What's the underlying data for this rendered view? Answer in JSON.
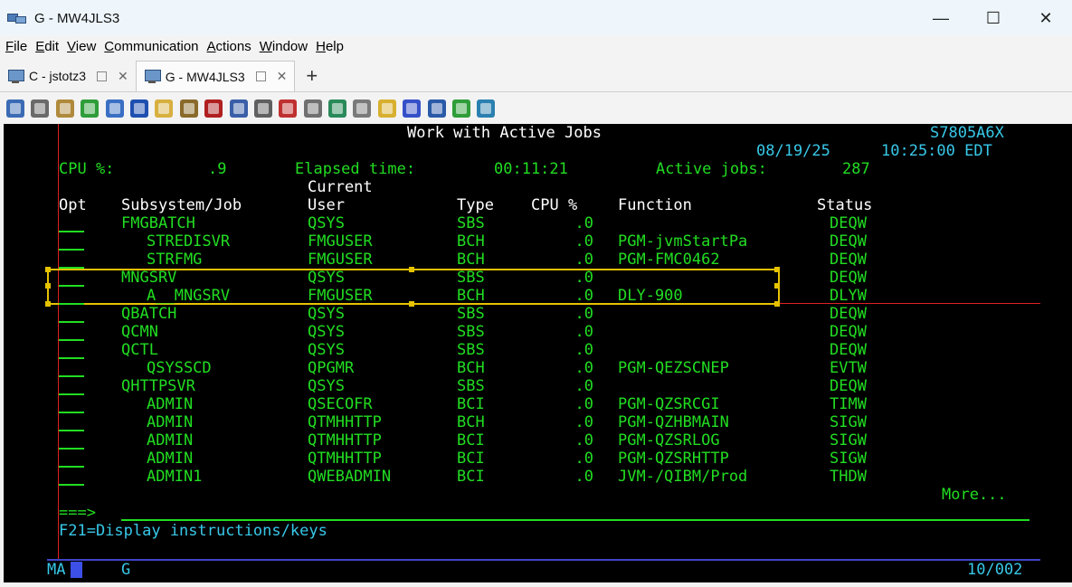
{
  "window": {
    "title": "G - MW4JLS3",
    "minimize": "—",
    "maximize": "☐",
    "close": "✕"
  },
  "menu": [
    "File",
    "Edit",
    "View",
    "Communication",
    "Actions",
    "Window",
    "Help"
  ],
  "tabs": [
    {
      "label": "C - jstotz3",
      "active": false
    },
    {
      "label": "G - MW4JLS3",
      "active": true
    }
  ],
  "toolbar_icons": [
    {
      "name": "copy-screen-icon",
      "color": "#3b6bb5"
    },
    {
      "name": "copy-icon",
      "color": "#6a6a6a"
    },
    {
      "name": "paste-icon",
      "color": "#b08a3c"
    },
    {
      "name": "receive-file-icon",
      "color": "#2e9d3a"
    },
    {
      "name": "save-icon",
      "color": "#3a6fc4"
    },
    {
      "name": "macro-play-icon",
      "color": "#1f4fb0"
    },
    {
      "name": "record-macro-icon",
      "color": "#d8b040"
    },
    {
      "name": "package-icon",
      "color": "#8a6a2a"
    },
    {
      "name": "sql-icon",
      "color": "#b02020"
    },
    {
      "name": "keyboard-icon",
      "color": "#3a5fa8"
    },
    {
      "name": "tools-icon",
      "color": "#606060"
    },
    {
      "name": "robot-icon",
      "color": "#c03030"
    },
    {
      "name": "printer-icon",
      "color": "#707070"
    },
    {
      "name": "connect-icon",
      "color": "#2a8a5a"
    },
    {
      "name": "disconnect-icon",
      "color": "#7a7a7a"
    },
    {
      "name": "notepad-icon",
      "color": "#d8b030"
    },
    {
      "name": "help-icon",
      "color": "#3550c8"
    },
    {
      "name": "settings-icon",
      "color": "#2a5aa8"
    },
    {
      "name": "upload-icon",
      "color": "#2e9d3a"
    },
    {
      "name": "screenshot-icon",
      "color": "#2a80b0"
    }
  ],
  "terminal": {
    "title": "Work with Active Jobs",
    "system": "S7805A6X",
    "date": "08/19/25",
    "time": "10:25:00 EDT",
    "cpu_label": "CPU %:",
    "cpu_value": ".9",
    "elapsed_label": "Elapsed time:",
    "elapsed_value": "00:11:21",
    "active_label": "Active jobs:",
    "active_value": "287",
    "headers": {
      "current": "Current",
      "opt": "Opt",
      "job": "Subsystem/Job",
      "user": "User",
      "type": "Type",
      "cpu": "CPU %",
      "function": "Function",
      "status": "Status"
    },
    "rows": [
      {
        "job": "FMGBATCH",
        "indent": false,
        "user": "QSYS",
        "type": "SBS",
        "cpu": ".0",
        "function": "",
        "status": "DEQW"
      },
      {
        "job": "STREDISVR",
        "indent": true,
        "user": "FMGUSER",
        "type": "BCH",
        "cpu": ".0",
        "function": "PGM-jvmStartPa",
        "status": "DEQW"
      },
      {
        "job": "STRFMG",
        "indent": true,
        "user": "FMGUSER",
        "type": "BCH",
        "cpu": ".0",
        "function": "PGM-FMC0462",
        "status": "DEQW"
      },
      {
        "job": "MNGSRV",
        "indent": false,
        "user": "QSYS",
        "type": "SBS",
        "cpu": ".0",
        "function": "",
        "status": "DEQW"
      },
      {
        "job": "A__MNGSRV",
        "indent": true,
        "user": "FMGUSER",
        "type": "BCH",
        "cpu": ".0",
        "function": "DLY-900",
        "status": "DLYW"
      },
      {
        "job": "QBATCH",
        "indent": false,
        "user": "QSYS",
        "type": "SBS",
        "cpu": ".0",
        "function": "",
        "status": "DEQW"
      },
      {
        "job": "QCMN",
        "indent": false,
        "user": "QSYS",
        "type": "SBS",
        "cpu": ".0",
        "function": "",
        "status": "DEQW"
      },
      {
        "job": "QCTL",
        "indent": false,
        "user": "QSYS",
        "type": "SBS",
        "cpu": ".0",
        "function": "",
        "status": "DEQW"
      },
      {
        "job": "QSYSSCD",
        "indent": true,
        "user": "QPGMR",
        "type": "BCH",
        "cpu": ".0",
        "function": "PGM-QEZSCNEP",
        "status": "EVTW"
      },
      {
        "job": "QHTTPSVR",
        "indent": false,
        "user": "QSYS",
        "type": "SBS",
        "cpu": ".0",
        "function": "",
        "status": "DEQW"
      },
      {
        "job": "ADMIN",
        "indent": true,
        "user": "QSECOFR",
        "type": "BCI",
        "cpu": ".0",
        "function": "PGM-QZSRCGI",
        "status": "TIMW"
      },
      {
        "job": "ADMIN",
        "indent": true,
        "user": "QTMHHTTP",
        "type": "BCH",
        "cpu": ".0",
        "function": "PGM-QZHBMAIN",
        "status": "SIGW"
      },
      {
        "job": "ADMIN",
        "indent": true,
        "user": "QTMHHTTP",
        "type": "BCI",
        "cpu": ".0",
        "function": "PGM-QZSRLOG",
        "status": "SIGW"
      },
      {
        "job": "ADMIN",
        "indent": true,
        "user": "QTMHHTTP",
        "type": "BCI",
        "cpu": ".0",
        "function": "PGM-QZSRHTTP",
        "status": "SIGW"
      },
      {
        "job": "ADMIN1",
        "indent": true,
        "user": "QWEBADMIN",
        "type": "BCI",
        "cpu": ".0",
        "function": "JVM-/QIBM/Prod",
        "status": "THDW"
      }
    ],
    "more": "More...",
    "prompt": "===>",
    "fkeys": "F21=Display instructions/keys",
    "oia_mode": "MA",
    "oia_session": "G",
    "cursor_pos": "10/002"
  }
}
